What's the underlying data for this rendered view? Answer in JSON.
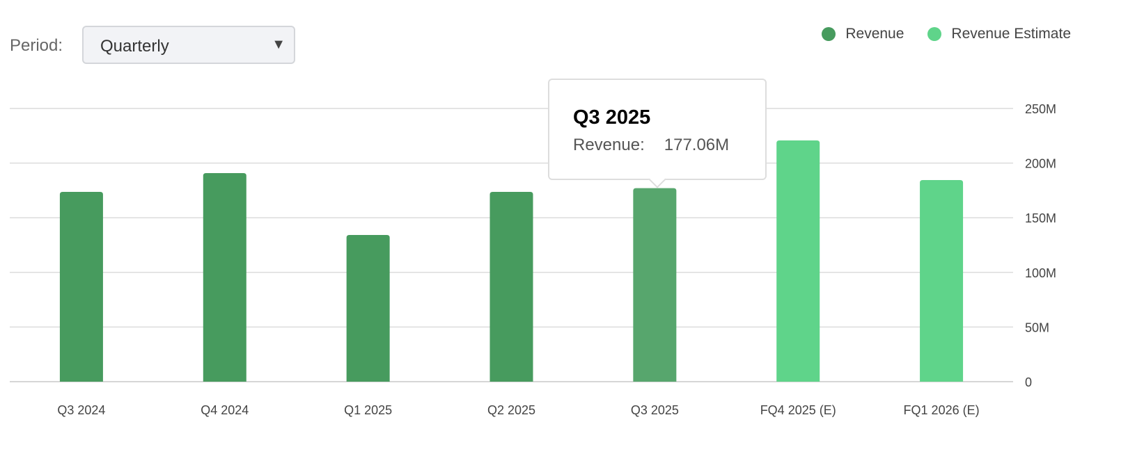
{
  "controls": {
    "period_label": "Period:",
    "period_value": "Quarterly"
  },
  "colors": {
    "revenue": "#479b5e",
    "revenue_hover": "#57a66d",
    "estimate": "#5fd48a",
    "grid": "#dcdcdc"
  },
  "tooltip": {
    "title": "Q3 2025",
    "label": "Revenue:",
    "value": "177.06M"
  },
  "chart_data": {
    "type": "bar",
    "categories": [
      "Q3 2024",
      "Q4 2024",
      "Q1 2025",
      "Q2 2025",
      "Q3 2025",
      "FQ4 2025 (E)",
      "FQ1 2026 (E)"
    ],
    "series": [
      {
        "name": "Revenue",
        "values": [
          173.7,
          190.8,
          134.2,
          173.7,
          177.06,
          null,
          null
        ]
      },
      {
        "name": "Revenue Estimate",
        "values": [
          null,
          null,
          null,
          null,
          null,
          220.7,
          184.5
        ]
      }
    ],
    "ylim": [
      0,
      250
    ],
    "yticks": [
      0,
      50,
      100,
      150,
      200,
      250
    ],
    "ytick_labels": [
      "0",
      "50M",
      "100M",
      "150M",
      "200M",
      "250M"
    ],
    "legend": "top-right",
    "grid": true,
    "highlighted": "Q3 2025"
  }
}
